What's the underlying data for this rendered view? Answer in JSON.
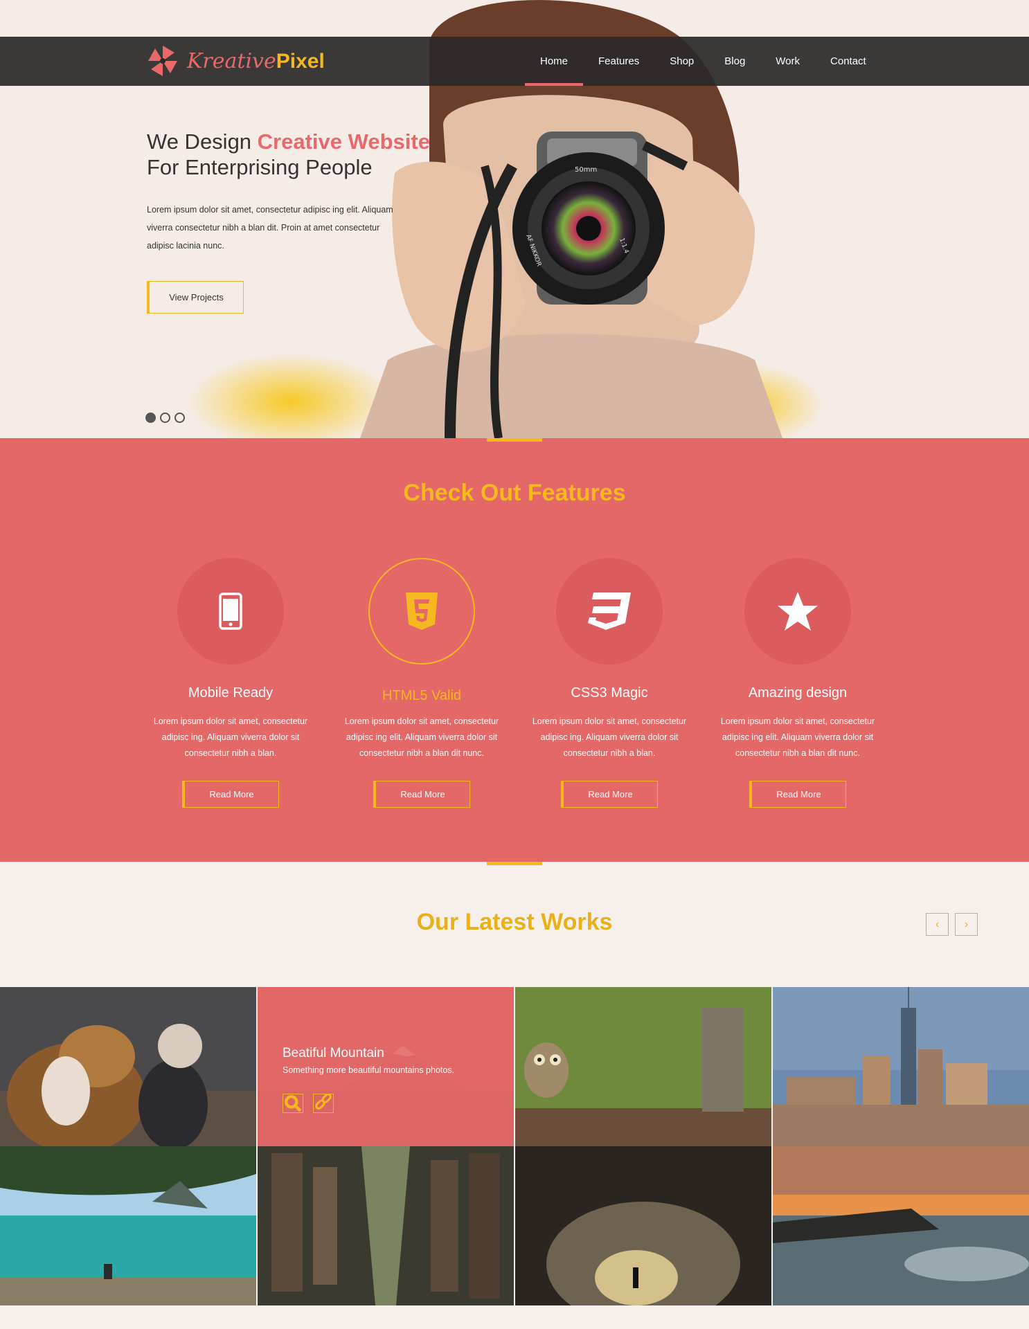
{
  "brand": {
    "name_part1": "Kreative",
    "name_part2": "Pixel",
    "primary_color": "#e9696b",
    "accent_color": "#f5b81f"
  },
  "nav": {
    "items": [
      {
        "label": "Home",
        "active": true
      },
      {
        "label": "Features",
        "active": false
      },
      {
        "label": "Shop",
        "active": false
      },
      {
        "label": "Blog",
        "active": false
      },
      {
        "label": "Work",
        "active": false
      },
      {
        "label": "Contact",
        "active": false
      }
    ]
  },
  "hero": {
    "title_part1": "We Design ",
    "title_accent": "Creative Website",
    "title_line2": "For Enterprising People",
    "text": "Lorem ipsum dolor sit amet, consectetur adipisc ing elit. Aliquam viverra consectetur nibh a blan dit. Proin at amet consectetur adipisc lacinia nunc.",
    "button_label": "View Projects",
    "slides": 3,
    "active_slide": 1,
    "camera_lens_text": "50mm",
    "camera_brand_text": "AF NIKKOR",
    "camera_aperture_text": "1:1.4"
  },
  "features": {
    "title_part1": "Check Out ",
    "title_bold": "Features",
    "items": [
      {
        "icon": "mobile-icon",
        "title": "Mobile Ready",
        "text": "Lorem ipsum dolor sit amet, consectetur adipisc ing. Aliquam viverra  dolor sit consectetur nibh a blan.",
        "button": "Read  More"
      },
      {
        "icon": "html5-icon",
        "title": "HTML5 Valid",
        "text": "Lorem ipsum dolor sit amet, consectetur adipisc ing elit. Aliquam viverra  dolor sit consectetur nibh a blan dit nunc.",
        "button": "Read  More"
      },
      {
        "icon": "css3-icon",
        "title": "CSS3 Magic",
        "text": "Lorem ipsum dolor sit amet, consectetur adipisc ing. Aliquam viverra  dolor sit consectetur nibh a blan.",
        "button": "Read  More"
      },
      {
        "icon": "star-icon",
        "title": "Amazing design",
        "text": "Lorem ipsum dolor sit amet, consectetur adipisc ing elit. Aliquam viverra  dolor sit consectetur nibh a blan dit nunc.",
        "button": "Read  More"
      }
    ]
  },
  "works": {
    "title_part1": "Our Latest ",
    "title_bold": "Works",
    "prev_icon": "chevron-left-icon",
    "next_icon": "chevron-right-icon",
    "featured": {
      "title": "Beatiful Mountain",
      "subtitle": "Something more beautiful mountains photos."
    }
  }
}
